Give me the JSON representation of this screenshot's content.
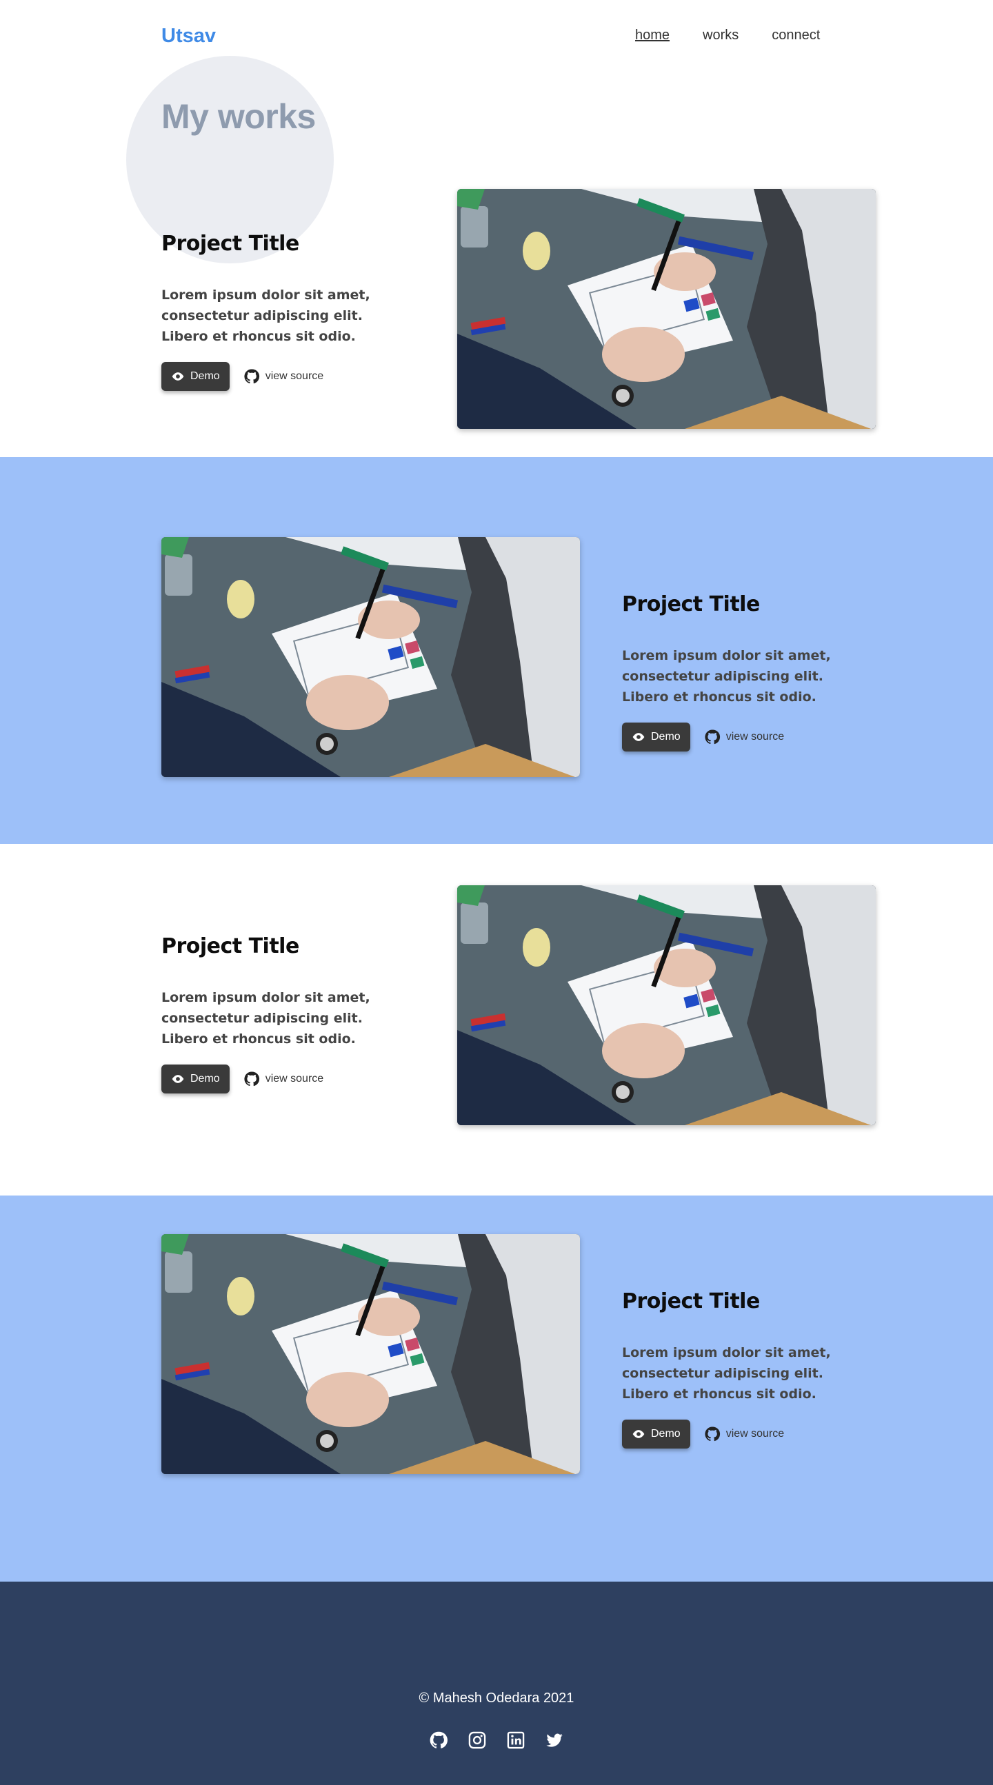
{
  "header": {
    "brand": "Utsav",
    "nav": [
      {
        "label": "home",
        "active": true
      },
      {
        "label": "works",
        "active": false
      },
      {
        "label": "connect",
        "active": false
      }
    ],
    "page_title": "My works"
  },
  "projects": [
    {
      "title": "Project Title",
      "description": "Lorem ipsum dolor sit amet, consectetur adipiscing elit. Libero et rhoncus sit odio.",
      "demo_label": "Demo",
      "source_label": "view source"
    },
    {
      "title": "Project Title",
      "description": "Lorem ipsum dolor sit amet, consectetur adipiscing elit. Libero et rhoncus sit odio.",
      "demo_label": "Demo",
      "source_label": "view source"
    },
    {
      "title": "Project Title",
      "description": "Lorem ipsum dolor sit amet, consectetur adipiscing elit. Libero et rhoncus sit odio.",
      "demo_label": "Demo",
      "source_label": "view source"
    },
    {
      "title": "Project Title",
      "description": "Lorem ipsum dolor sit amet, consectetur adipiscing elit. Libero et rhoncus sit odio.",
      "demo_label": "Demo",
      "source_label": "view source"
    }
  ],
  "footer": {
    "copyright": "© Mahesh Odedara 2021",
    "socials": [
      "github-icon",
      "instagram-icon",
      "linkedin-icon",
      "twitter-icon"
    ]
  },
  "colors": {
    "brand": "#3f8ae6",
    "alt_section": "#9dc0f9",
    "footer": "#2e4060",
    "button": "#3a3a3a"
  }
}
